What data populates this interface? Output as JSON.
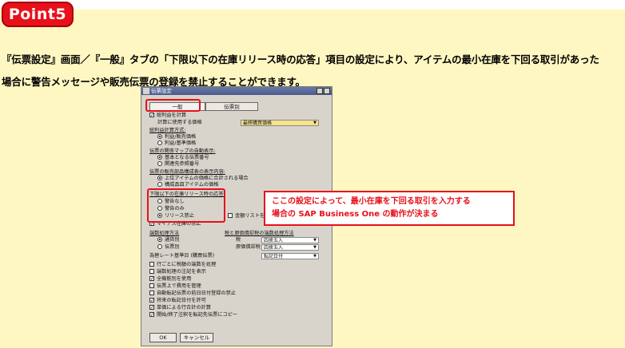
{
  "badge": "Point5",
  "description": {
    "line1": "『伝票設定』画面／『一般』タブの「下限以下の在庫リリース時の応答」項目の設定により、アイテムの最小在庫を下回る取引があった",
    "line2": "場合に警告メッセージや販売伝票の登録を禁止することができます。"
  },
  "dialog": {
    "title": "伝票設定",
    "tabs": [
      "一般",
      "伝票別"
    ],
    "profit_check": "総利益を計算",
    "price_label": "計算に使用する価格",
    "price_value": "最終購買価格",
    "profit_section": "総利益計算方式:",
    "profit_options": [
      "利益/販売価格",
      "利益/基準価格"
    ],
    "relation_section": "伝票の関係マップの自動表示:",
    "relation_options": [
      "基本となる伝票番号",
      "関連先参照番号"
    ],
    "bom_section": "伝票の販売部品構成表の表示内容:",
    "bom_options": [
      "上位アイテムの価格に合計される場合",
      "構成品目アイテムの価格"
    ],
    "stock_section": "下限以下の在庫リリース時の応答:",
    "stock_options": [
      "警告なし",
      "警告のみ",
      "リリース禁止"
    ],
    "stock_side": "金額リストを使用",
    "negative_stock": "マイナス在庫の禁止",
    "rounding_section": "端数処理方法",
    "rounding_options": [
      "通貨別",
      "伝票別"
    ],
    "rate_section": "税と原価償却税の端数処理方法",
    "rate_rows": [
      {
        "label": "税",
        "value": "四捨五入"
      },
      {
        "label": "原価償却税",
        "value": "四捨五入"
      }
    ],
    "rate_base_label": "為替レート基準日 (購買伝票)",
    "rate_base_value": "転記日付",
    "checks": [
      {
        "label": "行ごとに税額の端数を処理",
        "checked": false
      },
      {
        "label": "端数処理の注記を表示",
        "checked": false
      },
      {
        "label": "全機能別を使用",
        "checked": true
      },
      {
        "label": "伝票上で費用を管理",
        "checked": false
      },
      {
        "label": "自動転記伝票の前日日付登録の禁止",
        "checked": false
      },
      {
        "label": "将来の転記日付を許可",
        "checked": true
      },
      {
        "label": "単価による行合計の計算",
        "checked": true
      },
      {
        "label": "開始/終了注釈を転記先伝票にコピー",
        "checked": true
      }
    ],
    "ok": "OK",
    "cancel": "キャンセル"
  },
  "callout": {
    "line1": "ここの設定によって、最小在庫を下回る取引を入力する",
    "line2": "場合の SAP Business One の動作が決まる"
  },
  "colors": {
    "accent_red": "#e8101a",
    "background_yellow": "#fff7c2",
    "dialog_gray": "#d8d4cc"
  }
}
